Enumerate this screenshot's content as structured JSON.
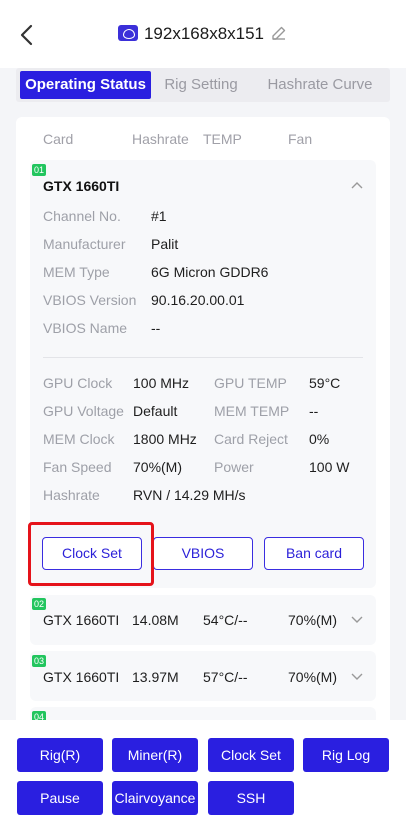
{
  "header": {
    "title": "192x168x8x151"
  },
  "tabs": [
    {
      "label": "Operating Status"
    },
    {
      "label": "Rig Setting"
    },
    {
      "label": "Hashrate Curve"
    }
  ],
  "columns": [
    "Card",
    "Hashrate",
    "TEMP",
    "Fan"
  ],
  "card1": {
    "index": "01",
    "name": "GTX 1660TI",
    "info": [
      {
        "label": "Channel No.",
        "value": "#1"
      },
      {
        "label": "Manufacturer",
        "value": "Palit"
      },
      {
        "label": "MEM Type",
        "value": "6G Micron GDDR6"
      },
      {
        "label": "VBIOS Version",
        "value": "90.16.20.00.01"
      },
      {
        "label": "VBIOS Name",
        "value": "--"
      }
    ],
    "stats": [
      {
        "label": "GPU Clock",
        "value": "100 MHz",
        "label2": "GPU TEMP",
        "value2": "59°C"
      },
      {
        "label": "GPU Voltage",
        "value": "Default",
        "label2": "MEM TEMP",
        "value2": "--"
      },
      {
        "label": "MEM Clock",
        "value": "1800 MHz",
        "label2": "Card Reject",
        "value2": "0%"
      },
      {
        "label": "Fan Speed",
        "value": "70%(M)",
        "label2": "Power",
        "value2": "100 W"
      },
      {
        "label": "Hashrate",
        "value": "RVN / 14.29 MH/s"
      }
    ],
    "buttons": {
      "clock_set": "Clock Set",
      "vbios": "VBIOS",
      "ban_card": "Ban card"
    }
  },
  "rows": [
    {
      "index": "02",
      "name": "GTX 1660TI",
      "hashrate": "14.08M",
      "temp": "54°C/--",
      "fan": "70%(M)"
    },
    {
      "index": "03",
      "name": "GTX 1660TI",
      "hashrate": "13.97M",
      "temp": "57°C/--",
      "fan": "70%(M)"
    },
    {
      "index": "04"
    }
  ],
  "footer": {
    "rig": "Rig(R)",
    "miner": "Miner(R)",
    "clock_set": "Clock Set",
    "rig_log": "Rig Log",
    "pause": "Pause",
    "clairvoyance": "Clairvoyance",
    "ssh": "SSH"
  }
}
